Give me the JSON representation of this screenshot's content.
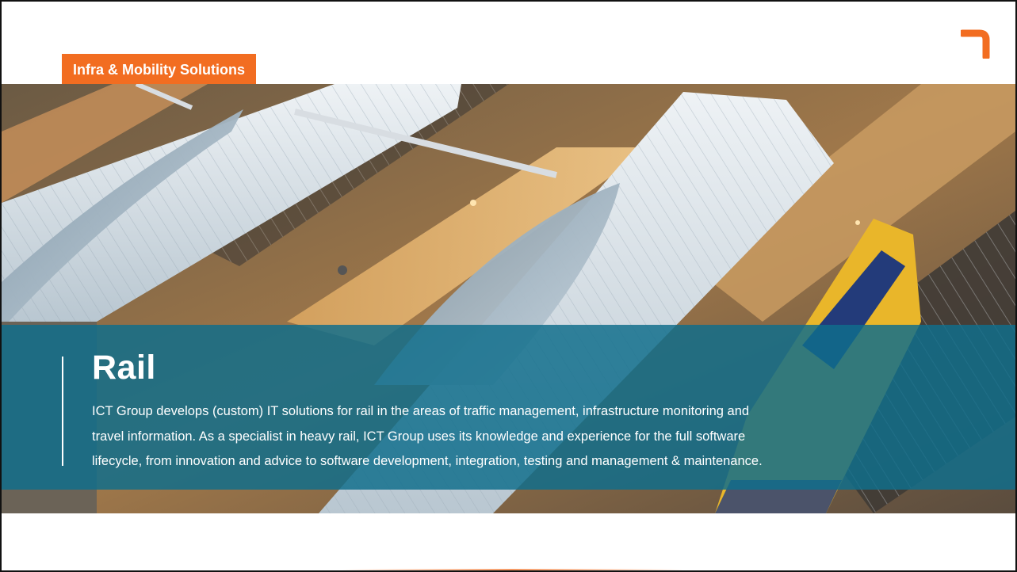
{
  "header": {
    "tag_label": "Infra & Mobility Solutions",
    "accent_color": "#f26d21"
  },
  "hero": {
    "image_description_icon": "rail-station-aerial-photo"
  },
  "overlay": {
    "title": "Rail",
    "body_lines": [
      "ICT Group develops (custom) IT solutions for rail in the areas of traffic management, infrastructure monitoring and",
      "travel information. As a specialist in heavy rail, ICT Group uses its knowledge and experience for the full software",
      "lifecycle, from innovation and advice to software development, integration, testing and management & maintenance."
    ],
    "background_color": "#106e8c"
  },
  "logo": {
    "icon": "corner-bracket-logo",
    "color": "#f26d21"
  }
}
